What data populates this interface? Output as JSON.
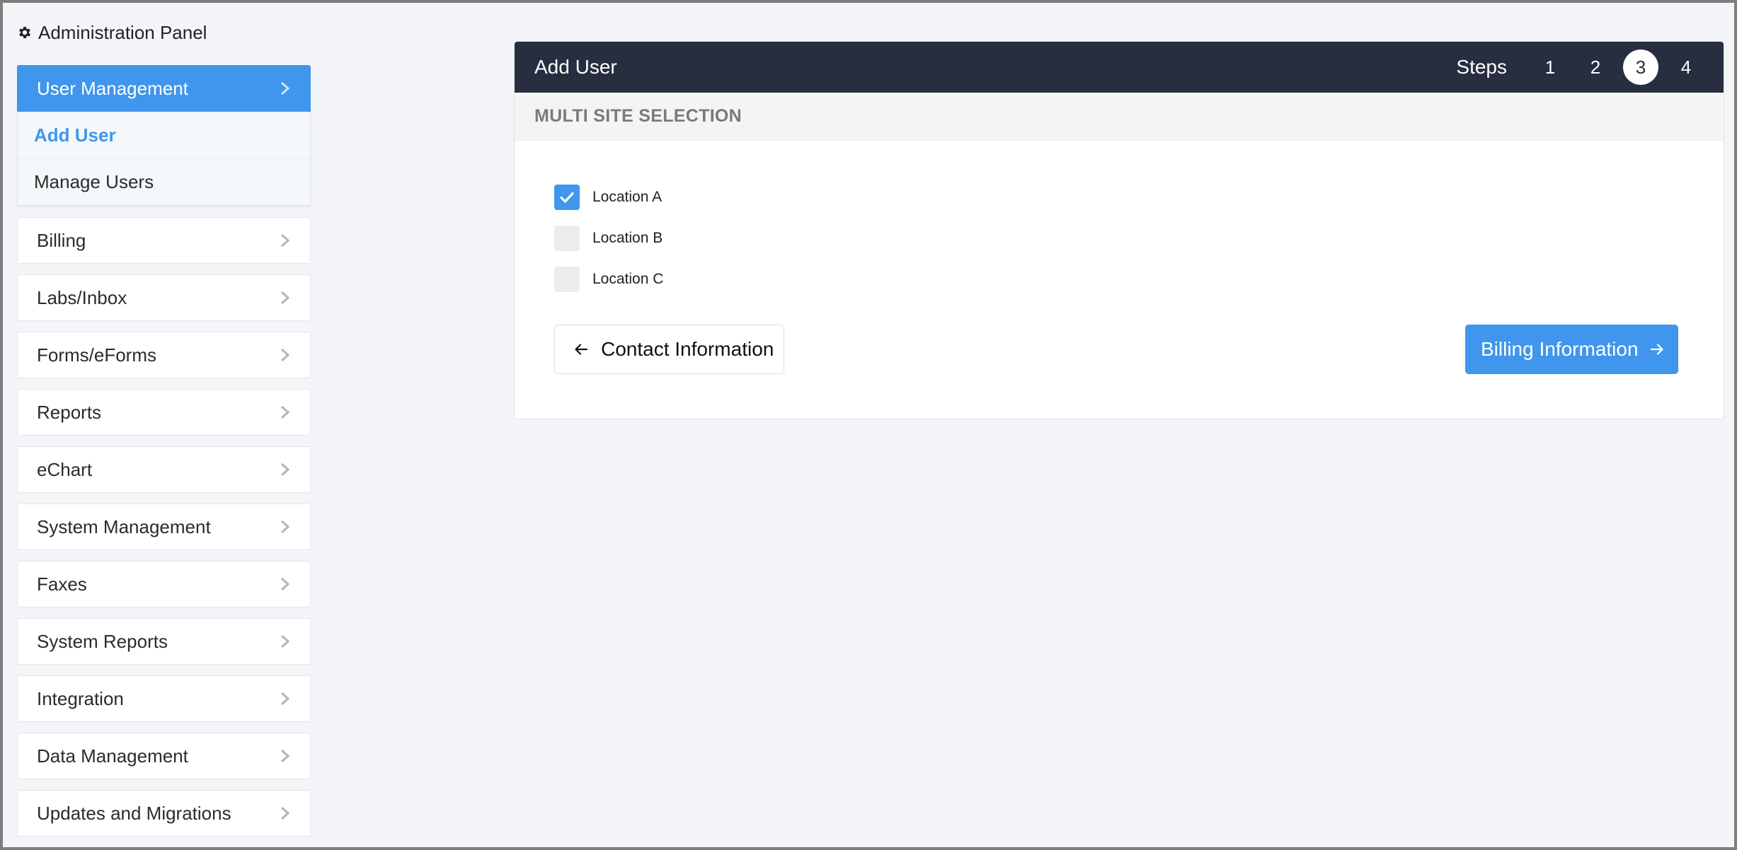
{
  "panel": {
    "title": "Administration Panel"
  },
  "sidebar": {
    "active_section": "User Management",
    "submenu": [
      {
        "label": "Add User",
        "current": true
      },
      {
        "label": "Manage Users",
        "current": false
      }
    ],
    "items": [
      "Billing",
      "Labs/Inbox",
      "Forms/eForms",
      "Reports",
      "eChart",
      "System Management",
      "Faxes",
      "System Reports",
      "Integration",
      "Data Management",
      "Updates and Migrations"
    ]
  },
  "card": {
    "title": "Add User",
    "steps_label": "Steps",
    "steps": [
      "1",
      "2",
      "3",
      "4"
    ],
    "current_step": "3",
    "section_title": "MULTI SITE SELECTION",
    "locations": [
      {
        "label": "Location A",
        "checked": true
      },
      {
        "label": "Location B",
        "checked": false
      },
      {
        "label": "Location C",
        "checked": false
      }
    ],
    "back_button": "Contact Information",
    "next_button": "Billing Information"
  },
  "colors": {
    "accent": "#3f96ec",
    "header_bg": "#262e3f",
    "page_bg": "#f4f5f9"
  },
  "icons": {
    "panel": "gear-icon",
    "nav": "chevron-right-icon",
    "back": "arrow-left-icon",
    "next": "arrow-right-icon",
    "check": "checkmark-icon"
  }
}
